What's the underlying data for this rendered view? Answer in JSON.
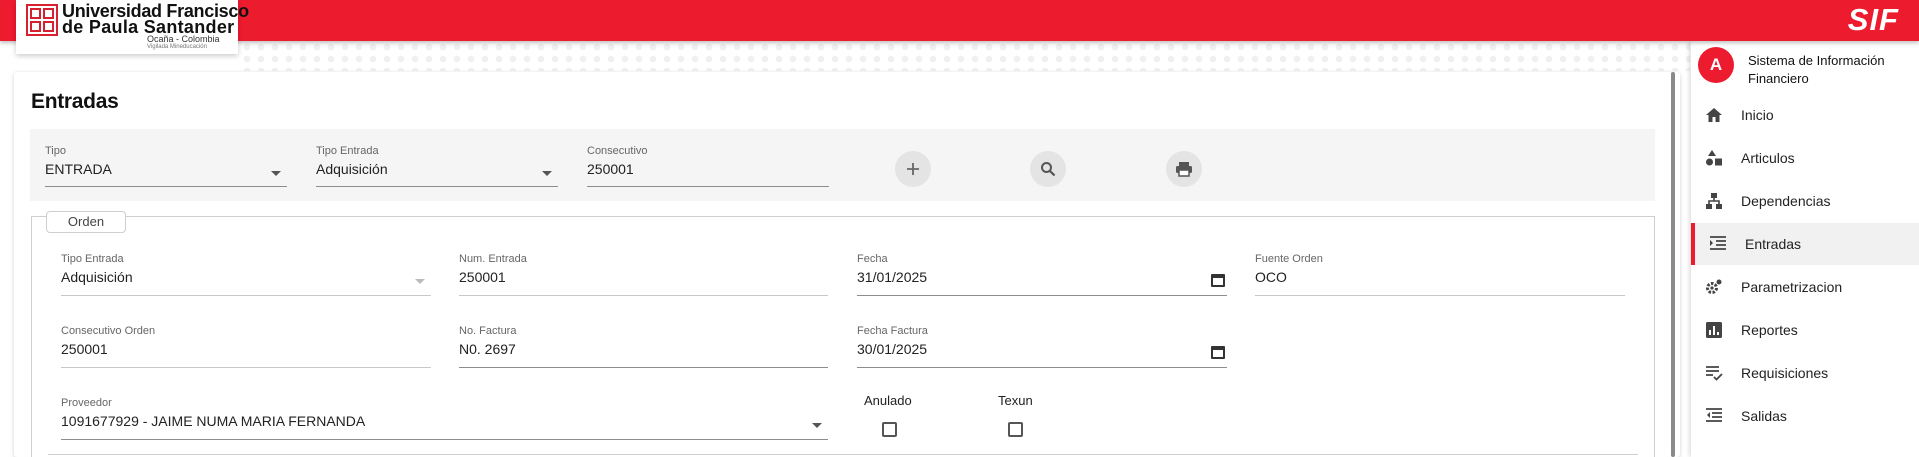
{
  "header": {
    "logo_line1": "Universidad Francisco",
    "logo_line2": "de Paula Santander",
    "logo_line3": "Ocaña - Colombia",
    "logo_line4": "Vigilada Mineducación",
    "brand": "SIF",
    "brand_color": "#ed1b2e"
  },
  "page": {
    "title": "Entradas"
  },
  "filters": {
    "tipo": {
      "label": "Tipo",
      "value": "ENTRADA"
    },
    "tipo_entrada": {
      "label": "Tipo Entrada",
      "value": "Adquisición"
    },
    "consecutivo": {
      "label": "Consecutivo",
      "value": "250001"
    },
    "buttons": [
      "plus-icon",
      "search-icon",
      "print-icon"
    ]
  },
  "orden": {
    "legend": "Orden",
    "tipo_entrada": {
      "label": "Tipo Entrada",
      "value": "Adquisición"
    },
    "num_entrada": {
      "label": "Num. Entrada",
      "value": "250001"
    },
    "fecha": {
      "label": "Fecha",
      "value": "31/01/2025"
    },
    "fuente_orden": {
      "label": "Fuente Orden",
      "value": "OCO"
    },
    "consecutivo_orden": {
      "label": "Consecutivo Orden",
      "value": "250001"
    },
    "no_factura": {
      "label": "No. Factura",
      "value": "N0. 2697"
    },
    "fecha_factura": {
      "label": "Fecha Factura",
      "value": "30/01/2025"
    },
    "proveedor": {
      "label": "Proveedor",
      "value": "1091677929 - JAIME NUMA MARIA FERNANDA"
    },
    "anulado": {
      "label": "Anulado",
      "checked": false
    },
    "texun": {
      "label": "Texun",
      "checked": false
    }
  },
  "sidebar": {
    "avatar": "A",
    "title": "Sistema de Información Financiero",
    "items": [
      {
        "label": "Inicio",
        "icon": "home-icon"
      },
      {
        "label": "Articulos",
        "icon": "shapes-icon"
      },
      {
        "label": "Dependencias",
        "icon": "hierarchy-icon"
      },
      {
        "label": "Entradas",
        "icon": "indent-icon",
        "active": true
      },
      {
        "label": "Parametrizacion",
        "icon": "gears-icon"
      },
      {
        "label": "Reportes",
        "icon": "bar-chart-icon"
      },
      {
        "label": "Requisiciones",
        "icon": "checklist-icon"
      },
      {
        "label": "Salidas",
        "icon": "outdent-icon"
      }
    ]
  }
}
